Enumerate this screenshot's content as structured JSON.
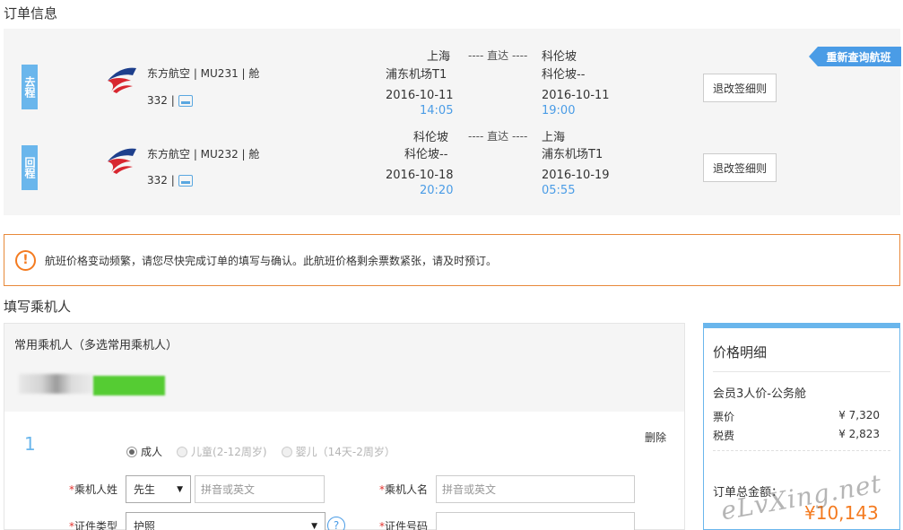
{
  "order_section": {
    "title": "订单信息"
  },
  "requery_button": "重新查询航班",
  "flights": [
    {
      "direction": "去程",
      "airline": "东方航空 | MU231 | 舱",
      "aircraft": "332 |",
      "from_city": "上海",
      "from_airport": "浦东机场T1",
      "connector": "---- 直达 ----",
      "to_city": "科伦坡",
      "to_airport": "科伦坡--",
      "depart_date": "2016-10-11",
      "depart_time": "14:05",
      "arrive_date": "2016-10-11",
      "arrive_time": "19:00",
      "rules_button": "退改签细则"
    },
    {
      "direction": "回程",
      "airline": "东方航空 | MU232 | 舱",
      "aircraft": "332 |",
      "from_city": "科伦坡",
      "from_airport": "科伦坡--",
      "connector": "---- 直达 ----",
      "to_city": "上海",
      "to_airport": "浦东机场T1",
      "depart_date": "2016-10-18",
      "depart_time": "20:20",
      "arrive_date": "2016-10-19",
      "arrive_time": "05:55",
      "rules_button": "退改签细则"
    }
  ],
  "warning": {
    "icon": "exclamation-circle-icon",
    "text": "航班价格变动频繁，请您尽快完成订单的填写与确认。此航班价格剩余票数紧张，请及时预订。"
  },
  "passenger_section": {
    "title": "填写乘机人"
  },
  "frequent": {
    "title": "常用乘机人（多选常用乘机人）"
  },
  "passenger_form": {
    "index": "1",
    "delete_label": "删除",
    "types": [
      {
        "label": "成人",
        "checked": true,
        "disabled": false
      },
      {
        "label": "儿童(2-12周岁)",
        "checked": false,
        "disabled": true
      },
      {
        "label": "婴儿（14天-2周岁）",
        "checked": false,
        "disabled": true
      }
    ],
    "surname_label": "乘机人姓",
    "title_select": "先生",
    "surname_placeholder": "拼音或英文",
    "given_label": "乘机人名",
    "given_placeholder": "拼音或英文",
    "doc_type_label": "证件类型",
    "doc_type_select": "护照",
    "doc_no_label": "证件号码",
    "required_mark": "*",
    "help_icon": "question-circle-icon",
    "help_label": "?"
  },
  "price": {
    "title": "价格明细",
    "fare_type": "会员3人价-公务舱",
    "rows": [
      {
        "label": "票价",
        "value": "¥ 7,320"
      },
      {
        "label": "税费",
        "value": "¥ 2,823"
      }
    ],
    "total_label": "订单总金额：",
    "total_value": "¥10,143"
  },
  "watermark": "eLvXing.net",
  "colors": {
    "accent": "#4a9ce6",
    "tag": "#6ab6ec",
    "warning": "#f47b20",
    "green": "#55cc33"
  }
}
